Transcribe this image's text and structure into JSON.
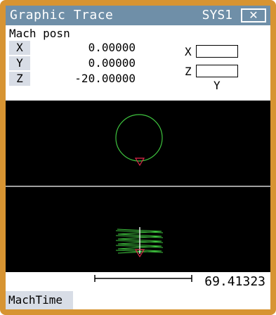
{
  "window": {
    "title": "Graphic Trace",
    "system": "SYS1",
    "close_symbol": "✕"
  },
  "machine_position": {
    "label": "Mach posn",
    "axes": [
      {
        "name": "X",
        "value": "0.00000"
      },
      {
        "name": "Y",
        "value": "0.00000"
      },
      {
        "name": "Z",
        "value": "-20.00000"
      }
    ]
  },
  "plane_fields": {
    "field1_label": "X",
    "field2_label": "Z",
    "bottom_label": "Y"
  },
  "scale": {
    "value": "69.41323"
  },
  "softkey": {
    "label": "MachTime"
  },
  "colors": {
    "trace": "#3ec23e",
    "tool": "#e0284a",
    "frame": "#d79432",
    "title_bg": "#6f8fa8"
  }
}
